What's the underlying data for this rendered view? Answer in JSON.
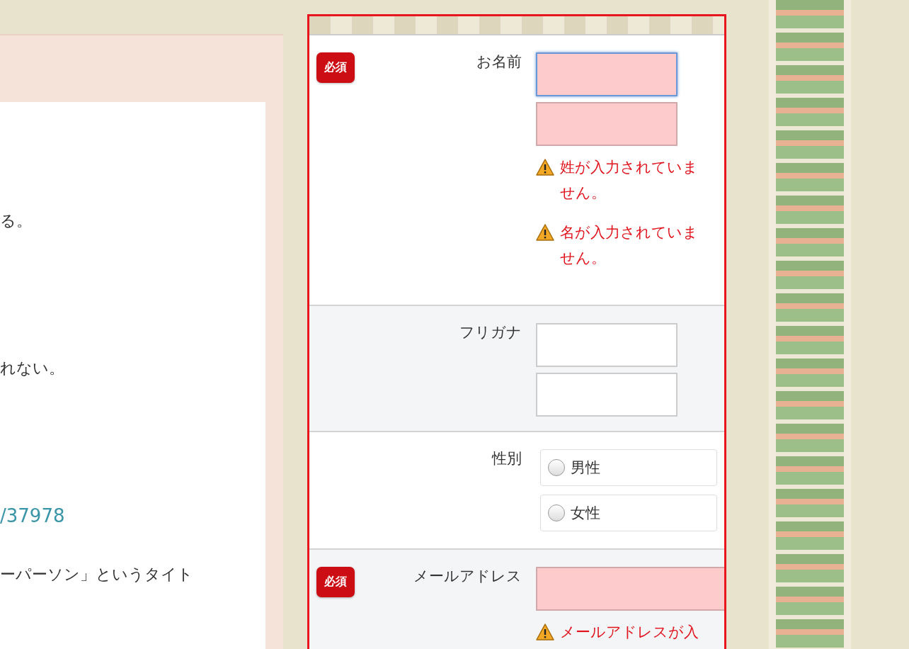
{
  "article": {
    "paragraphs": [
      {
        "kind": "text",
        "text": "る。"
      },
      {
        "kind": "text",
        "text": "れない。"
      },
      {
        "kind": "link",
        "text": "/37978"
      },
      {
        "kind": "text",
        "text": "ーパーソン」というタイト"
      }
    ]
  },
  "form": {
    "rows": [
      {
        "kind": "text",
        "label": "お名前",
        "badge": "必須",
        "fields": [
          {
            "error": true,
            "focused": true
          },
          {
            "error": true,
            "focused": false
          }
        ],
        "errors": [
          "姓が入力されていません。",
          "名が入力されていません。"
        ]
      },
      {
        "kind": "text",
        "label": "フリガナ",
        "fields": [
          {
            "error": false,
            "focused": false
          },
          {
            "error": false,
            "focused": false
          }
        ]
      },
      {
        "kind": "radio",
        "label": "性別",
        "options": [
          {
            "label": "男性",
            "selected": false
          },
          {
            "label": "女性",
            "selected": false
          }
        ]
      },
      {
        "kind": "wide",
        "label": "メールアドレス",
        "badge": "必須",
        "fields": [
          {
            "error": true,
            "focused": false
          }
        ],
        "errors": [
          "メールアドレスが入"
        ]
      }
    ]
  }
}
